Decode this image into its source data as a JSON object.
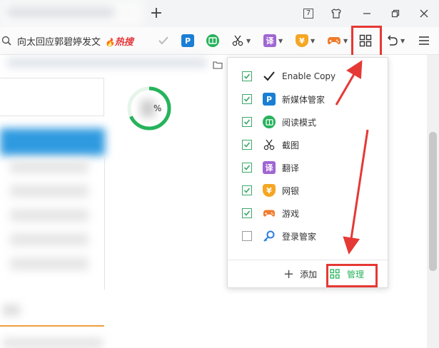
{
  "titlebar": {
    "tab_count": "7",
    "new_tab_symbol": "+"
  },
  "search": {
    "query": "向太回应郭碧婷发文",
    "hot_badge": "热搜"
  },
  "page": {
    "gauge_text": "%"
  },
  "dropdown": {
    "items": [
      {
        "label": "Enable Copy",
        "checked": true,
        "icon": "checkmark-icon"
      },
      {
        "label": "新媒体管家",
        "checked": true,
        "icon": "p-icon"
      },
      {
        "label": "阅读模式",
        "checked": true,
        "icon": "book-icon"
      },
      {
        "label": "截图",
        "checked": true,
        "icon": "scissors-icon"
      },
      {
        "label": "翻译",
        "checked": true,
        "icon": "translate-icon"
      },
      {
        "label": "网银",
        "checked": true,
        "icon": "shield-yen-icon"
      },
      {
        "label": "游戏",
        "checked": true,
        "icon": "gamepad-icon"
      },
      {
        "label": "登录管家",
        "checked": false,
        "icon": "key-icon"
      }
    ],
    "add_symbol": "+",
    "add_label": "添加",
    "manage_label": "管理"
  },
  "colors": {
    "accent_green": "#26b35b",
    "annotation_red": "#e53935",
    "p_blue": "#1a7fd4",
    "translate_purple": "#a066d3",
    "bank_orange": "#f5a623",
    "game_orange": "#f07b2b"
  }
}
